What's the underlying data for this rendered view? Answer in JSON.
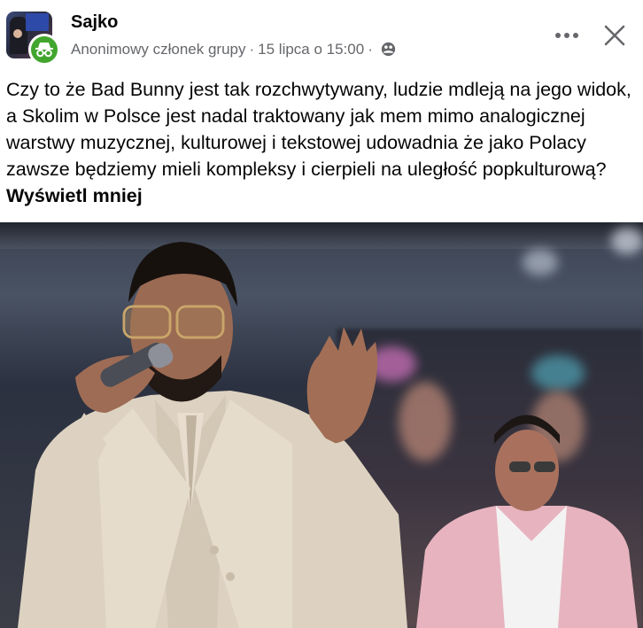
{
  "post": {
    "author": "Sajko",
    "meta_role": "Anonimowy członek grupy",
    "meta_date": "15 lipca o 15:00",
    "separator": "·",
    "text": "Czy to że Bad Bunny jest tak rozchwytywany, ludzie mdleją na jego widok, a Skolim w Polsce jest nadal traktowany jak mem mimo analogicznej warstwy muzycznej, kulturowej i tekstowej udowadnia że jako Polacy zawsze będziemy mieli kompleksy i cierpieli na uległość popkulturową?",
    "see_more": "Wyświetl mniej"
  },
  "icons": {
    "avatar_badge": "incognito-icon",
    "privacy": "group-globe-icon",
    "more": "more-horizontal-icon",
    "close": "close-icon"
  },
  "colors": {
    "badge_green": "#42a62e",
    "meta_gray": "#65676b",
    "text": "#050505"
  }
}
